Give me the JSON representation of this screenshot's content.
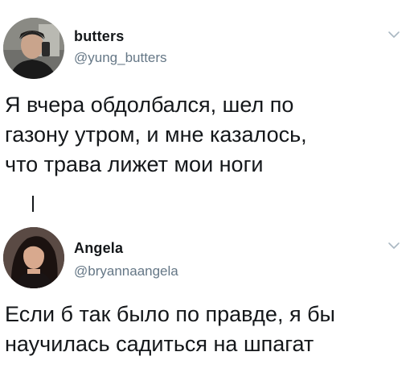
{
  "tweets": [
    {
      "display_name": "butters",
      "handle": "@yung_butters",
      "text": "Я вчера обдолбался, шел по\nгазону утром, и мне казалось,\nчто трава лижет мои ноги",
      "avatar": "profile-photo"
    },
    {
      "display_name": "Angela",
      "handle": "@bryannaangela",
      "text": "Если б так было по правде, я бы\nнаучилась садиться на шпагат",
      "avatar": "profile-photo"
    }
  ],
  "icons": {
    "menu_caret": "chevron-down-icon"
  },
  "colors": {
    "text": "#14171a",
    "handle": "#657786",
    "caret": "#aab8c2",
    "background": "#ffffff"
  }
}
